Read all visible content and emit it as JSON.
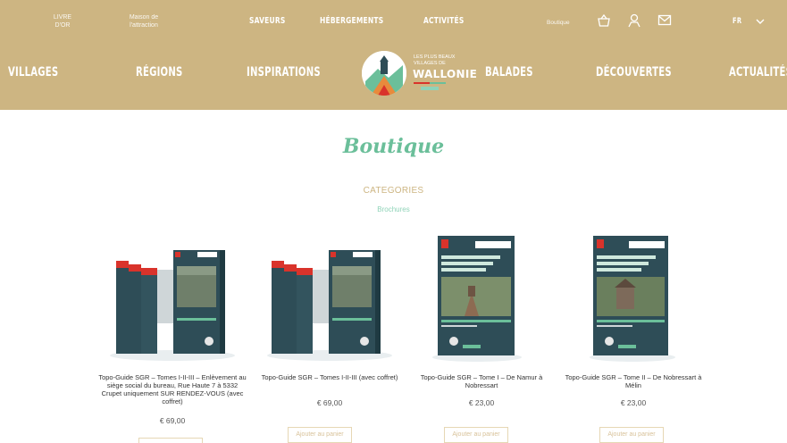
{
  "top_nav": {
    "left_item_1": [
      "LIVRE",
      "D'OR"
    ],
    "left_item_2": [
      "Maison de",
      "l'attraction"
    ],
    "saveurs": "SAVEURS",
    "hebergements": "HÉBERGEMENTS",
    "activites": "ACTIVITÉS",
    "boutique": "Boutique",
    "language": "FR",
    "icons": [
      "basket-icon",
      "user-icon",
      "mail-icon",
      "chevron-down-icon"
    ]
  },
  "main_nav": {
    "villages": "VILLAGES",
    "regions": "RÉGIONS",
    "inspirations": "INSPIRATIONS",
    "balades": "BALADES",
    "decouvertes": "DÉCOUVERTES",
    "actualites": "ACTUALITÉS"
  },
  "logo": {
    "line1": "LES PLUS BEAUX",
    "line2": "VILLAGES DE",
    "wallonie": "WALLONIE"
  },
  "page": {
    "title": "Boutique",
    "categories_label": "CATEGORIES",
    "category_link": "Brochures"
  },
  "products": [
    {
      "name": "Topo-Guide SGR – Tomes I-II-III – Enlèvement au siège social du bureau, Rue Haute 7 à 5332 Crupet uniquement SUR RENDEZ-VOUS (avec coffret)",
      "price": "€ 69,00",
      "button": ""
    },
    {
      "name": "Topo-Guide SGR – Tomes I-II-III (avec coffret)",
      "price": "€ 69,00",
      "button": "Ajouter au panier"
    },
    {
      "name": "Topo-Guide SGR – Tome I – De Namur à Nobressart",
      "price": "€ 23,00",
      "button": "Ajouter au panier"
    },
    {
      "name": "Topo-Guide SGR – Tome II – De Nobressart à Mélin",
      "price": "€ 23,00",
      "button": "Ajouter au panier"
    }
  ],
  "colors": {
    "header_bg": "#cdb582",
    "title_green": "#6bbf9a",
    "book_blue": "#2e4d57",
    "accent_red": "#d9332b"
  }
}
